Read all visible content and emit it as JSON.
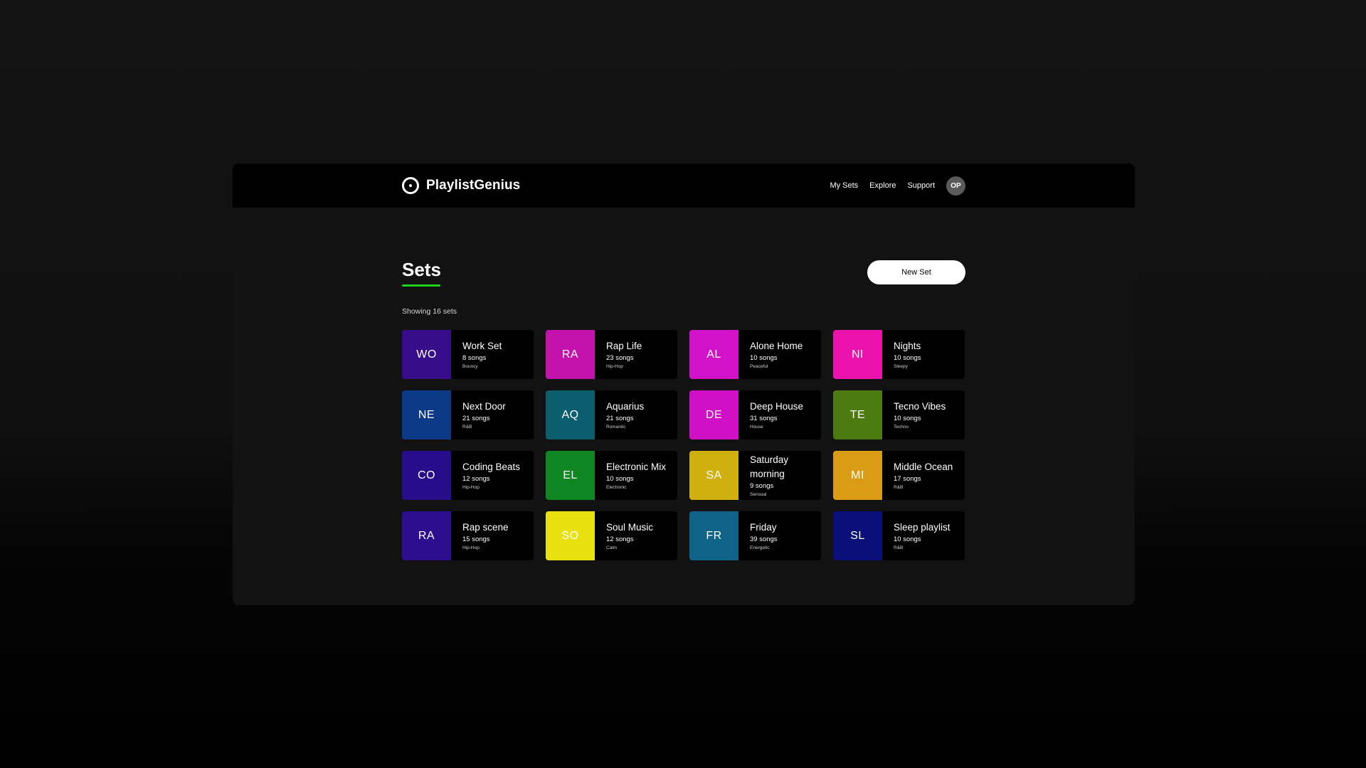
{
  "brand": {
    "name": "PlaylistGenius",
    "logo_icon": "vinyl-record-icon"
  },
  "nav": {
    "items": [
      "My Sets",
      "Explore",
      "Support"
    ],
    "avatar_initials": "OP"
  },
  "page": {
    "title": "Sets",
    "accent_color": "#1ed21e",
    "new_set_label": "New Set",
    "showing_text": "Showing 16 sets"
  },
  "sets": [
    {
      "initials": "WO",
      "name": "Work Set",
      "songs": "8 songs",
      "genre": "Bouncy",
      "color": "#380d8c"
    },
    {
      "initials": "RA",
      "name": "Rap Life",
      "songs": "23 songs",
      "genre": "Hip-Hop",
      "color": "#c412ad"
    },
    {
      "initials": "AL",
      "name": "Alone Home",
      "songs": "10 songs",
      "genre": "Peaceful",
      "color": "#d212c9"
    },
    {
      "initials": "NI",
      "name": "Nights",
      "songs": "10 songs",
      "genre": "Sleepy",
      "color": "#ec12ad"
    },
    {
      "initials": "NE",
      "name": "Next Door",
      "songs": "21 songs",
      "genre": "R&B",
      "color": "#0c3a86"
    },
    {
      "initials": "AQ",
      "name": "Aquarius",
      "songs": "21 songs",
      "genre": "Romantic",
      "color": "#0a5e6e"
    },
    {
      "initials": "DE",
      "name": "Deep House",
      "songs": "31 songs",
      "genre": "House",
      "color": "#d010c6"
    },
    {
      "initials": "TE",
      "name": "Tecno Vibes",
      "songs": "10 songs",
      "genre": "Techno",
      "color": "#4e7a12"
    },
    {
      "initials": "CO",
      "name": "Coding Beats",
      "songs": "12 songs",
      "genre": "Hip-Hop",
      "color": "#280d8a"
    },
    {
      "initials": "EL",
      "name": "Electronic Mix",
      "songs": "10 songs",
      "genre": "Electronic",
      "color": "#0e8622"
    },
    {
      "initials": "SA",
      "name": "Saturday morning",
      "songs": "9 songs",
      "genre": "Sensual",
      "color": "#cfb00f"
    },
    {
      "initials": "MI",
      "name": "Middle Ocean",
      "songs": "17 songs",
      "genre": "R&B",
      "color": "#d99c14"
    },
    {
      "initials": "RA",
      "name": "Rap scene",
      "songs": "15 songs",
      "genre": "Hip-Hop",
      "color": "#2c0e8e"
    },
    {
      "initials": "SO",
      "name": "Soul Music",
      "songs": "12 songs",
      "genre": "Calm",
      "color": "#e9e10f"
    },
    {
      "initials": "FR",
      "name": "Friday",
      "songs": "39 songs",
      "genre": "Energetic",
      "color": "#0f6288"
    },
    {
      "initials": "SL",
      "name": "Sleep playlist",
      "songs": "10 songs",
      "genre": "R&B",
      "color": "#0a0f7a"
    }
  ]
}
